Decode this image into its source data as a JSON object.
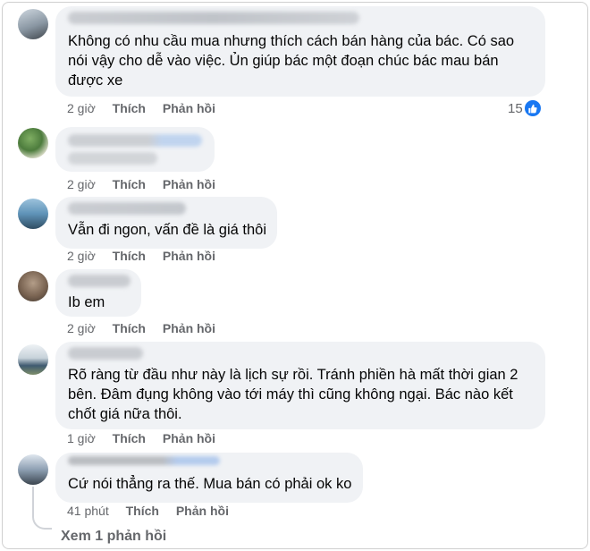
{
  "comments": [
    {
      "text": "Không có nhu cầu mua nhưng thích cách bán hàng của bác. Có sao\nnói vậy cho dễ vào việc. Ủn giúp bác một đoạn chúc bác mau bán\nđược xe",
      "time": "2 giờ",
      "like_label": "Thích",
      "reply_label": "Phản hồi",
      "reactions": "15",
      "avatar_colors": [
        "#6b7d8c",
        "#d8c9b8"
      ]
    },
    {
      "text": "",
      "time": "2 giờ",
      "like_label": "Thích",
      "reply_label": "Phản hồi",
      "avatar_colors": [
        "#5f8f4e",
        "#e6e3cf"
      ]
    },
    {
      "text": "Vẫn đi ngon, vấn đề là giá thôi",
      "time": "2 giờ",
      "like_label": "Thích",
      "reply_label": "Phản hồi",
      "avatar_colors": [
        "#3f6f95",
        "#b6cfe0"
      ]
    },
    {
      "text": "Ib em",
      "time": "2 giờ",
      "like_label": "Thích",
      "reply_label": "Phản hồi",
      "avatar_colors": [
        "#7a6a5c",
        "#c9b8a8"
      ]
    },
    {
      "text": "Rõ ràng từ đầu như này là lịch sự rồi. Tránh phiền hà mất thời gian 2\nbên. Đâm đụng không vào tới máy thì cũng không ngại. Bác nào kết\nchốt giá nữa thôi.",
      "time": "1 giờ",
      "like_label": "Thích",
      "reply_label": "Phản hồi",
      "avatar_colors": [
        "#4a6a86",
        "#dfe6ea"
      ]
    },
    {
      "text": "Cứ nói thẳng ra thế. Mua bán có phải ok ko",
      "time": "41 phút",
      "like_label": "Thích",
      "reply_label": "Phản hồi",
      "avatar_colors": [
        "#5a6a7c",
        "#cfd6de"
      ]
    }
  ],
  "view_replies": "Xem 1 phản hồi",
  "colors": {
    "bubble": "#f0f2f5",
    "meta": "#65676b",
    "like_blue": "#1877f2"
  }
}
